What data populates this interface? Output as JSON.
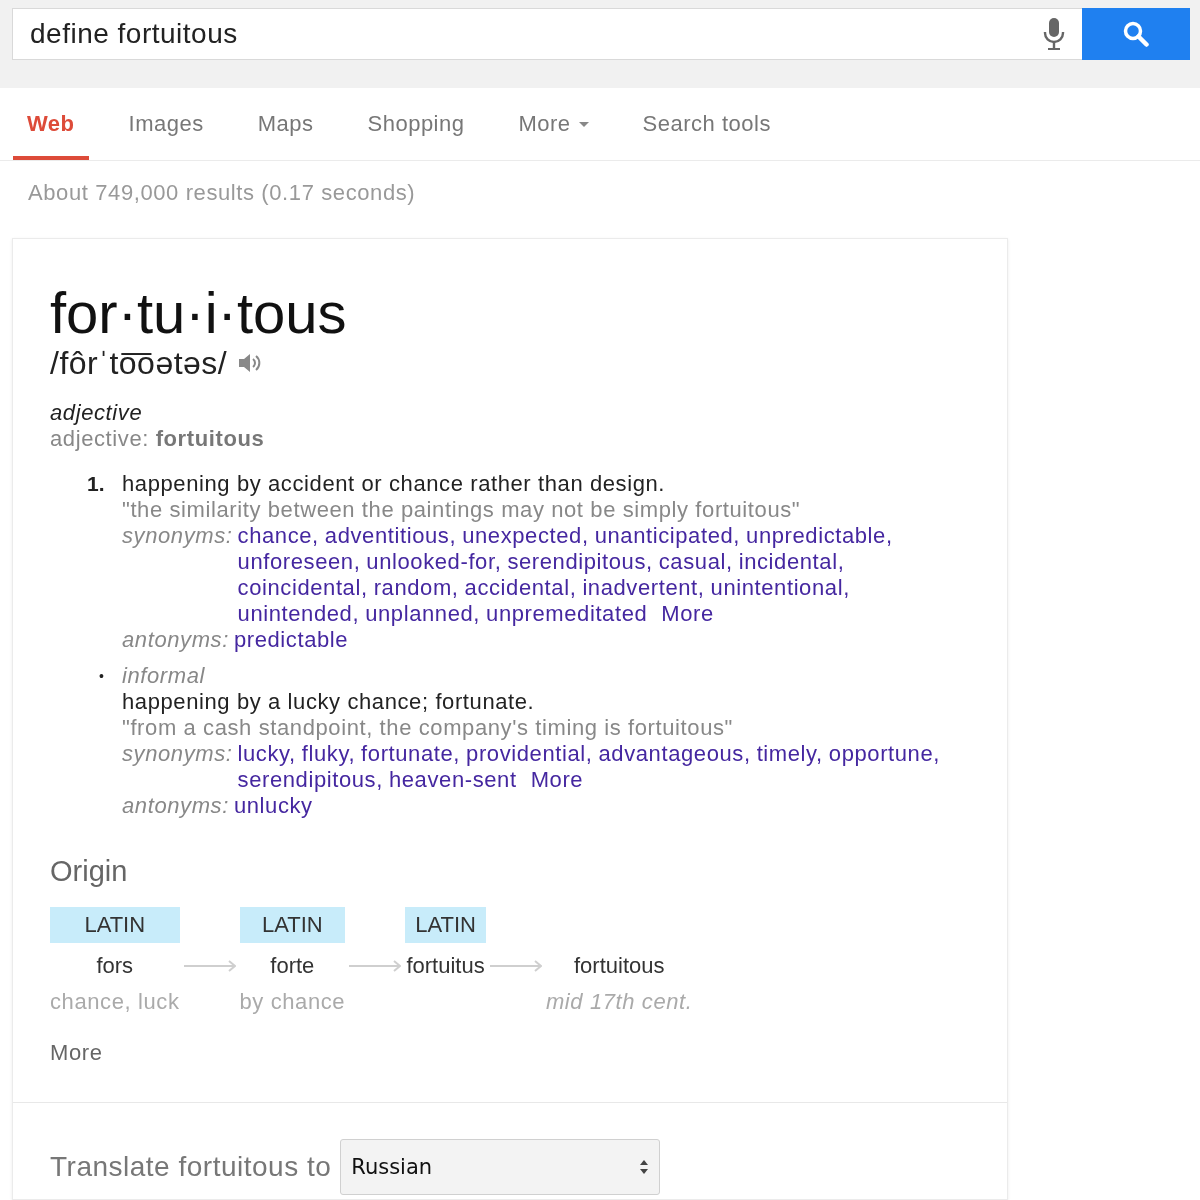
{
  "search": {
    "query": "define fortuitous"
  },
  "tabs": [
    {
      "label": "Web",
      "selected": true,
      "kind": "tab"
    },
    {
      "label": "Images",
      "selected": false,
      "kind": "tab"
    },
    {
      "label": "Maps",
      "selected": false,
      "kind": "tab"
    },
    {
      "label": "Shopping",
      "selected": false,
      "kind": "tab"
    },
    {
      "label": "More",
      "selected": false,
      "kind": "menu"
    },
    {
      "label": "Search tools",
      "selected": false,
      "kind": "tab"
    }
  ],
  "result_stats": "About 749,000 results (0.17 seconds)",
  "dictionary": {
    "headword": "for·tu·i·tous",
    "pronunciation": "/fôrˈto͞oətəs/",
    "part_of_speech": "adjective",
    "inflection": "adjective: **fortuitous**",
    "senses": [
      {
        "kind": "numbered",
        "marker": "1.",
        "definition": "happening by accident or chance rather than design.",
        "example": "\"the similarity between the paintings may not be simply fortuitous\"",
        "synonyms_label": "synonyms:",
        "synonyms": [
          "chance",
          "adventitious",
          "unexpected",
          "unanticipated",
          "unpredictable",
          "unforeseen",
          "unlooked-for",
          "serendipitous",
          "casual",
          "incidental",
          "coincidental",
          "random",
          "accidental",
          "inadvertent",
          "unintentional",
          "unintended",
          "unplanned",
          "unpremeditated"
        ],
        "separator": ",",
        "more": "More",
        "antonyms_label": "antonyms:",
        "antonyms": [
          "predictable"
        ]
      },
      {
        "kind": "bullet",
        "marker": "•",
        "register": "informal",
        "definition": "happening by a lucky chance; fortunate.",
        "example": "\"from a cash standpoint, the company's timing is fortuitous\"",
        "synonyms_label": "synonyms:",
        "synonyms": [
          "lucky",
          "fluky",
          "fortunate",
          "providential",
          "advantageous",
          "timely",
          "opportune",
          "serendipitous",
          "heaven-sent"
        ],
        "separator": ",",
        "more": "More",
        "antonyms_label": "antonyms:",
        "antonyms": [
          "unlucky"
        ]
      }
    ]
  },
  "origin": {
    "title": "Origin",
    "stages": [
      {
        "language": "LATIN",
        "word": "fors",
        "meaning": "chance, luck"
      },
      {
        "language": "LATIN",
        "word": "forte",
        "meaning": "by chance"
      },
      {
        "language": "LATIN",
        "word": "fortuitus"
      },
      {
        "word": "fortuitous",
        "date": "mid 17th cent."
      }
    ],
    "more": "More"
  },
  "translate": {
    "label": "Translate fortuitous to",
    "language": "Russian"
  }
}
